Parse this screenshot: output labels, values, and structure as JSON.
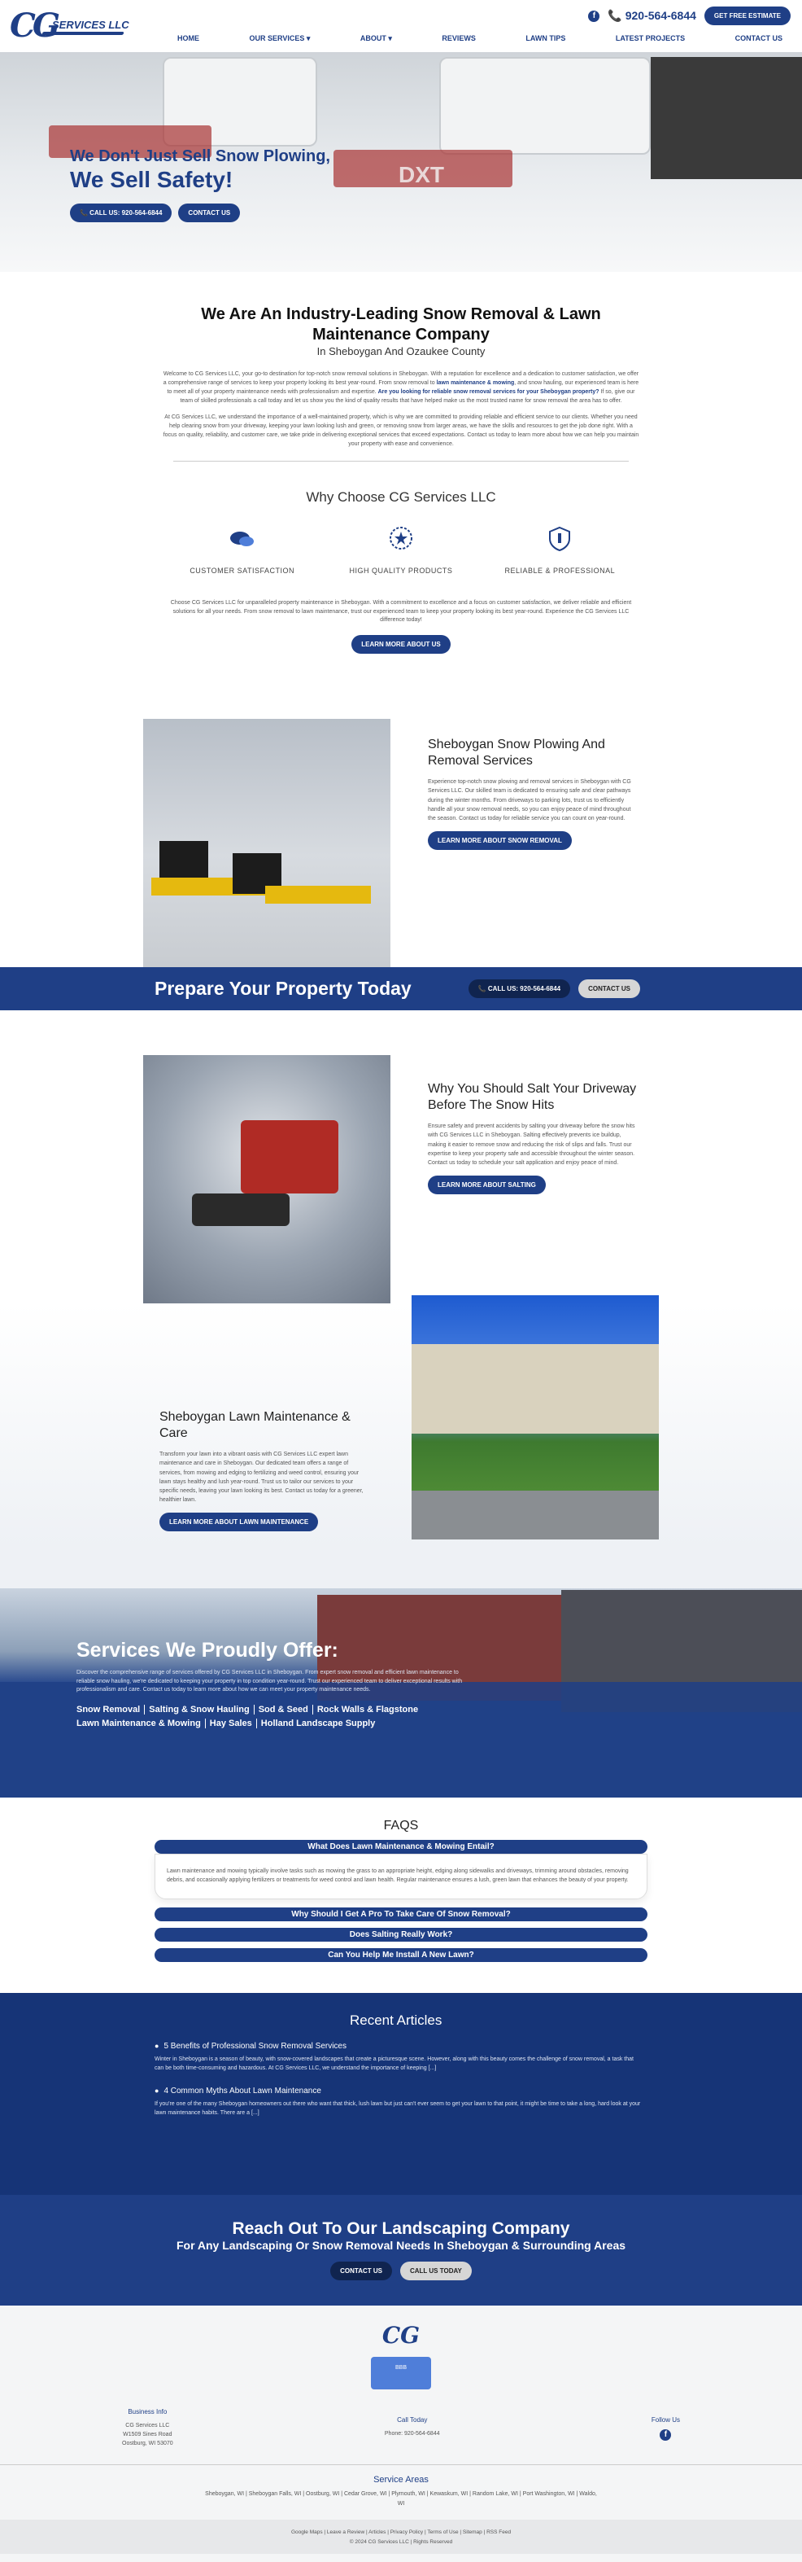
{
  "header": {
    "phone": "920-564-6844",
    "estimate_label": "GET FREE ESTIMATE",
    "logo_text": "CG",
    "logo_sub": "SERVICES LLC",
    "nav": [
      "HOME",
      "OUR SERVICES ▾",
      "ABOUT ▾",
      "REVIEWS",
      "LAWN TIPS",
      "LATEST PROJECTS",
      "CONTACT US"
    ]
  },
  "hero": {
    "title": "We Don't Just Sell Snow Plowing,",
    "subtitle": "We Sell Safety!",
    "call_label": "📞 CALL US: 920-564-6844",
    "contact_label": "CONTACT US",
    "truck_text": "DXT"
  },
  "intro": {
    "title": "We Are An Industry-Leading Snow Removal & Lawn Maintenance Company",
    "subtitle": "In Sheboygan And Ozaukee County",
    "p1_a": "Welcome to CG Services LLC, your go-to destination for top-notch snow removal solutions in Sheboygan. With a reputation for excellence and a dedication to customer satisfaction, we offer a comprehensive range of services to keep your property looking its best year-round. From snow removal to ",
    "p1_link": "lawn maintenance & mowing",
    "p1_b": ", and snow hauling, our experienced team is here to meet all of your property maintenance needs with professionalism and expertise. ",
    "p1_bold": "Are you looking for reliable snow removal services for your Sheboygan property?",
    "p1_c": " If so, give our team of skilled professionals a call today and let us show you the kind of quality results that have helped make us the most trusted name for snow removal the area has to offer.",
    "p2": "At CG Services LLC, we understand the importance of a well-maintained property, which is why we are committed to providing reliable and efficient service to our clients. Whether you need help clearing snow from your driveway, keeping your lawn looking lush and green, or removing snow from larger areas, we have the skills and resources to get the job done right. With a focus on quality, reliability, and customer care, we take pride in delivering exceptional services that exceed expectations. Contact us today to learn more about how we can help you maintain your property with ease and convenience."
  },
  "why": {
    "title": "Why Choose CG Services LLC",
    "features": [
      {
        "label": "CUSTOMER SATISFACTION"
      },
      {
        "label": "HIGH QUALITY PRODUCTS"
      },
      {
        "label": "RELIABLE & PROFESSIONAL"
      }
    ],
    "body": "Choose CG Services LLC for unparalleled property maintenance in Sheboygan. With a commitment to excellence and a focus on customer satisfaction, we deliver reliable and efficient solutions for all your needs. From snow removal to lawn maintenance, trust our experienced team to keep your property looking its best year-round. Experience the CG Services LLC difference today!",
    "button": "LEARN MORE ABOUT US"
  },
  "snow": {
    "title": "Sheboygan Snow Plowing And Removal Services",
    "body": "Experience top-notch snow plowing and removal services in Sheboygan with CG Services LLC. Our skilled team is dedicated to ensuring safe and clear pathways during the winter months. From driveways to parking lots, trust us to efficiently handle all your snow removal needs, so you can enjoy peace of mind throughout the season. Contact us today for reliable service you can count on year-round.",
    "button": "LEARN MORE ABOUT SNOW REMOVAL"
  },
  "band": {
    "title": "Prepare Your Property Today",
    "call_label": "📞 CALL US: 920-564-6844",
    "contact_label": "CONTACT US"
  },
  "salt": {
    "title": "Why You Should Salt Your Driveway Before The Snow Hits",
    "body": "Ensure safety and prevent accidents by salting your driveway before the snow hits with CG Services LLC in Sheboygan. Salting effectively prevents ice buildup, making it easier to remove snow and reducing the risk of slips and falls. Trust our expertise to keep your property safe and accessible throughout the winter season. Contact us today to schedule your salt application and enjoy peace of mind.",
    "button": "LEARN MORE ABOUT SALTING"
  },
  "lawn": {
    "title": "Sheboygan Lawn Maintenance & Care",
    "body": "Transform your lawn into a vibrant oasis with CG Services LLC expert lawn maintenance and care in Sheboygan. Our dedicated team offers a range of services, from mowing and edging to fertilizing and weed control, ensuring your lawn stays healthy and lush year-round. Trust us to tailor our services to your specific needs, leaving your lawn looking its best. Contact us today for a greener, healthier lawn.",
    "button": "LEARN MORE ABOUT LAWN MAINTENANCE"
  },
  "services": {
    "title": "Services We Proudly Offer:",
    "body": "Discover the comprehensive range of services offered by CG Services LLC in Sheboygan. From expert snow removal and efficient lawn maintenance to reliable snow hauling, we're dedicated to keeping your property in top condition year-round. Trust our experienced team to deliver exceptional results with professionalism and care. Contact us today to learn more about how we can meet your property maintenance needs.",
    "links": [
      "Snow Removal",
      "Salting & Snow Hauling",
      "Sod & Seed",
      "Rock Walls & Flagstone",
      "Lawn Maintenance & Mowing",
      "Hay Sales",
      "Holland Landscape Supply"
    ]
  },
  "faqs": {
    "title": "FAQS",
    "items": [
      {
        "q": "What Does Lawn Maintenance & Mowing Entail?",
        "a": "Lawn maintenance and mowing typically involve tasks such as mowing the grass to an appropriate height, edging along sidewalks and driveways, trimming around obstacles, removing debris, and occasionally applying fertilizers or treatments for weed control and lawn health. Regular maintenance ensures a lush, green lawn that enhances the beauty of your property."
      },
      {
        "q": "Why Should I Get A Pro To Take Care Of Snow Removal?"
      },
      {
        "q": "Does Salting Really Work?"
      },
      {
        "q": "Can You Help Me Install A New Lawn?"
      }
    ]
  },
  "articles": {
    "title": "Recent Articles",
    "items": [
      {
        "title": "5 Benefits of Professional Snow Removal Services",
        "excerpt": "Winter in Sheboygan is a season of beauty, with snow-covered landscapes that create a picturesque scene. However, along with this beauty comes the challenge of snow removal, a task that can be both time-consuming and hazardous. At CG Services LLC, we understand the importance of keeping [...]"
      },
      {
        "title": "4 Common Myths About Lawn Maintenance",
        "excerpt": "If you're one of the many Sheboygan homeowners out there who want that thick, lush lawn but just can't ever seem to get your lawn to that point, it might be time to take a long, hard look at your lawn maintenance habits. There are a [...]"
      }
    ]
  },
  "reach": {
    "title": "Reach Out To Our Landscaping Company",
    "subtitle": "For Any Landscaping Or Snow Removal Needs In Sheboygan & Surrounding Areas",
    "contact_label": "CONTACT US",
    "call_label": "CALL US TODAY"
  },
  "footer": {
    "logo": "CG",
    "badge": "BBB",
    "business_heading": "Business Info",
    "business_lines": [
      "CG Services LLC",
      "W1509 Sines Road",
      "Oostburg, WI 53070"
    ],
    "call_heading": "Call Today",
    "call_line": "Phone: 920-564-6844",
    "follow_heading": "Follow Us",
    "areas_heading": "Service Areas",
    "areas": "Sheboygan, WI | Sheboygan Falls, WI | Oostburg, WI | Cedar Grove, WI | Plymouth, WI | Kewaskum, WI | Random Lake, WI | Port Washington, WI | Waldo, WI",
    "links": "Google Maps | Leave a Review | Articles | Privacy Policy | Terms of Use | Sitemap | RSS Feed",
    "copyright": "© 2024 CG Services LLC | Rights Reserved"
  }
}
